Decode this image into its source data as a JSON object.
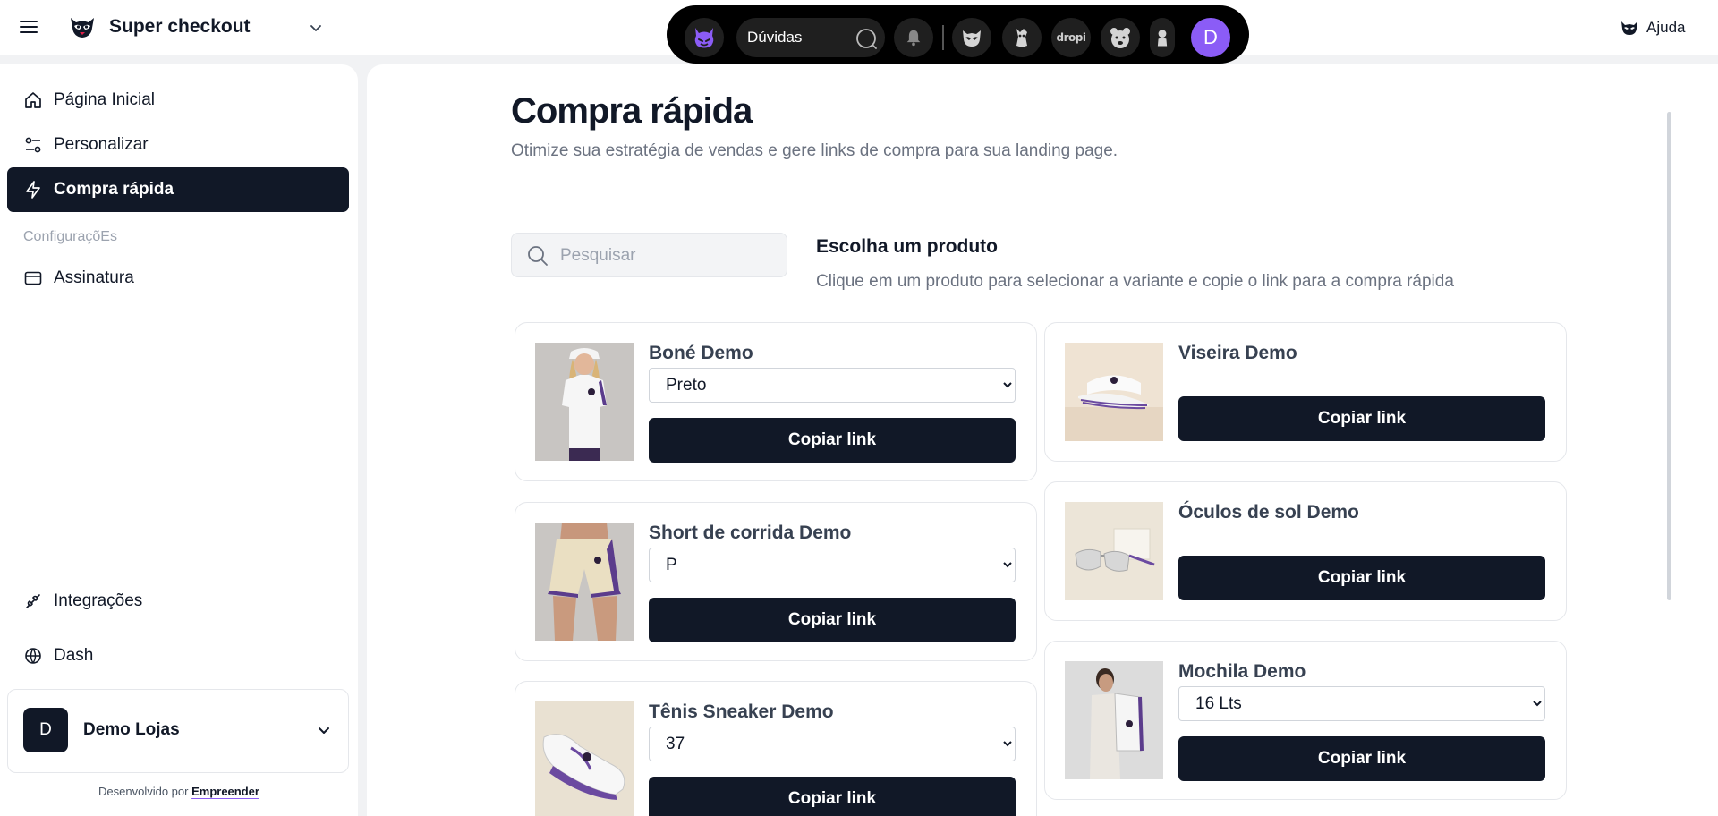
{
  "header": {
    "store_name": "Super checkout",
    "help_label": "Ajuda"
  },
  "appbar": {
    "search_label": "Dúvidas",
    "drop_label": "dropi",
    "user_initial": "D"
  },
  "sidebar": {
    "items": [
      {
        "label": "Página Inicial"
      },
      {
        "label": "Personalizar"
      },
      {
        "label": "Compra rápida"
      }
    ],
    "section_label": "ConfiguraçõEs",
    "settings_items": [
      {
        "label": "Assinatura"
      }
    ],
    "bottom_items": [
      {
        "label": "Integrações"
      },
      {
        "label": "Dash"
      }
    ],
    "store": {
      "initial": "D",
      "name": "Demo Lojas"
    },
    "credit_prefix": "Desenvolvido por",
    "credit_link": "Empreender"
  },
  "main": {
    "title": "Compra rápida",
    "subtitle": "Otimize sua estratégia de vendas e gere links de compra para sua landing page.",
    "search_placeholder": "Pesquisar",
    "choose_title": "Escolha um produto",
    "choose_subtitle": "Clique em um produto para selecionar a variante e copie o link para a compra rápida",
    "copy_label": "Copiar link",
    "products": [
      {
        "name": "Boné Demo",
        "variant": "Preto"
      },
      {
        "name": "Viseira Demo"
      },
      {
        "name": "Short de corrida Demo",
        "variant": "P"
      },
      {
        "name": "Óculos de sol Demo"
      },
      {
        "name": "Tênis Sneaker Demo",
        "variant": "37"
      },
      {
        "name": "Mochila Demo",
        "variant": "16 Lts"
      }
    ]
  },
  "colors": {
    "primary": "#111827",
    "accent": "#8b5cf6",
    "muted_text": "#6b7280",
    "border": "#e5e7eb"
  },
  "icons": {
    "menu": "hamburger-menu-icon",
    "brand": "raccoon-logo-icon",
    "home": "home-icon",
    "customize": "sliders-icon",
    "quick_buy": "lightning-icon",
    "subscription": "credit-card-icon",
    "integrations": "plug-icon",
    "dash": "globe-icon",
    "search": "search-icon",
    "bell": "bell-icon"
  }
}
